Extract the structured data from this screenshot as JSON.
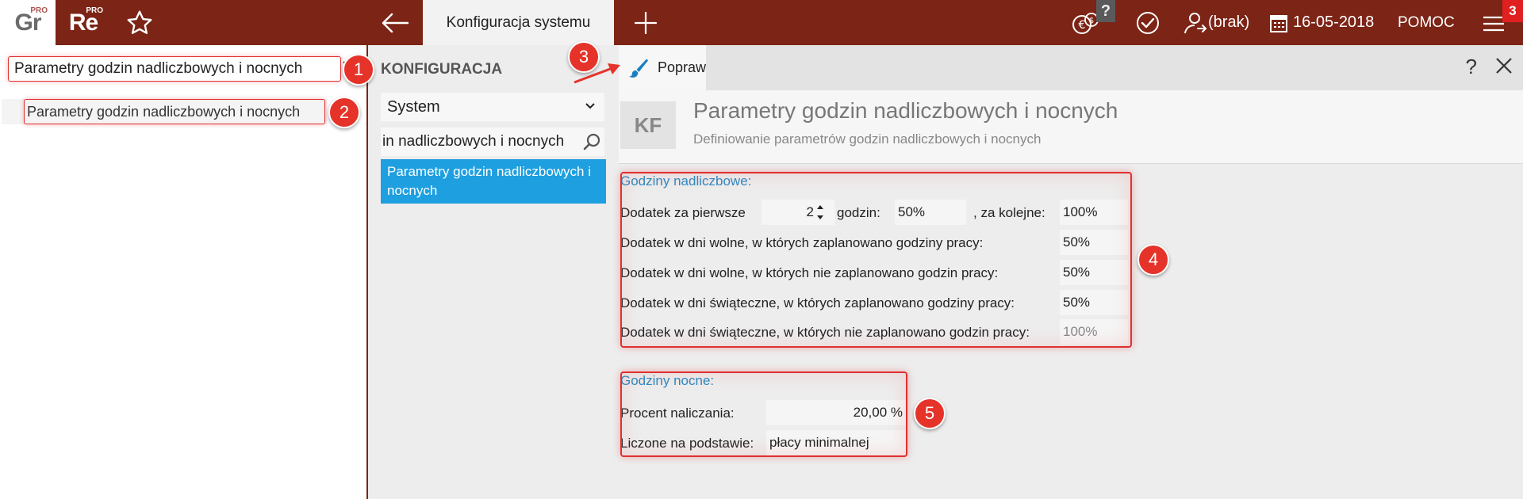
{
  "topbar": {
    "logo_gr": "Gr",
    "logo_gr_sup": "PRO",
    "logo_re": "Re",
    "logo_re_sup": "PRO",
    "active_tab": "Konfiguracja systemu",
    "user": "(brak)",
    "date": "16-05-2018",
    "help": "POMOC",
    "help_badge_q": "?",
    "menu_badge": "3",
    "icons": [
      "star-icon",
      "back-arrow-icon",
      "plus-icon",
      "euro-coins-icon",
      "check-circle-icon",
      "user-switch-icon",
      "calendar-icon",
      "hamburger-menu-icon"
    ]
  },
  "left": {
    "search_value": "Parametry godzin nadliczbowych i nocnych",
    "result": "Parametry godzin nadliczbowych i nocnych"
  },
  "middle": {
    "title": "KONFIGURACJA",
    "select_value": "System",
    "filter_value": "in nadliczbowych i nocnych",
    "selected_item": "Parametry godzin nadliczbowych i nocnych"
  },
  "right": {
    "edit_button": "Popraw",
    "help_q": "?",
    "badge": "KF",
    "title": "Parametry godzin nadliczbowych i nocnych",
    "subtitle": "Definiowanie parametrów godzin nadliczbowych i nocnych",
    "overtime": {
      "title": "Godziny nadliczbowe:",
      "first_label": "Dodatek za pierwsze",
      "first_hours": "2",
      "hours_label": "godzin:",
      "first_pct": "50%",
      "next_label": ", za kolejne:",
      "next_pct": "100%",
      "rows": [
        {
          "label": "Dodatek w dni wolne, w których zaplanowano godziny pracy:",
          "value": "50%"
        },
        {
          "label": "Dodatek w dni wolne, w których nie zaplanowano godzin pracy:",
          "value": "50%"
        },
        {
          "label": "Dodatek w dni świąteczne, w których zaplanowano godziny pracy:",
          "value": "50%"
        },
        {
          "label": "Dodatek w dni świąteczne, w których nie zaplanowano godzin pracy:",
          "value": "100%"
        }
      ]
    },
    "night": {
      "title": "Godziny nocne:",
      "percent_label": "Procent naliczania:",
      "percent_value": "20,00 %",
      "basis_label": "Liczone na podstawie:",
      "basis_value": "płacy minimalnej"
    }
  },
  "callouts": [
    "1",
    "2",
    "3",
    "4",
    "5"
  ],
  "colors": {
    "topbar": "#7c2416",
    "accent": "#1d9fe0",
    "callout": "#e5332a",
    "section_title": "#2a8bc4"
  }
}
